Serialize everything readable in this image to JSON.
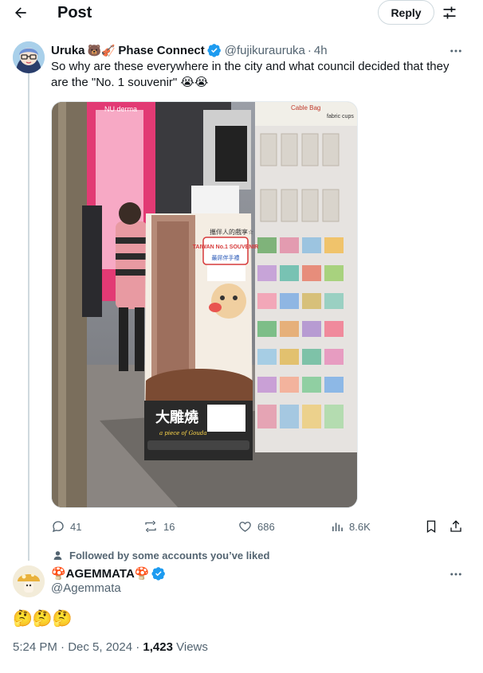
{
  "header": {
    "title": "Post",
    "reply_button": "Reply"
  },
  "tweet": {
    "author_name": "Uruka",
    "author_emoji": "🐻🎻",
    "author_org": "Phase Connect",
    "handle": "@fujikurauruka",
    "separator": "·",
    "time": "4h",
    "text": "So why are these everywhere in the city and what council decided that they are the \"No. 1 souvenir\" 😭😭",
    "media_sign_text": {
      "top": "攜伴人的戲享☆",
      "badge": "TAIWAN No.1 SOUVENIR",
      "subbadge": "最屌伴手禮",
      "brand": "大雕燒",
      "brand_sub": "a piece of Gouda",
      "shop_tag1": "NU derma",
      "shop_tag2": "Cable Bag",
      "shop_tag3": "fabric cups"
    },
    "stats": {
      "replies": "41",
      "reposts": "16",
      "likes": "686",
      "views": "8.6K"
    }
  },
  "reply": {
    "followed_note": "Followed by some accounts you’ve liked",
    "author_name": "🍄AGEMMATA🍄",
    "handle": "@Agemmata",
    "text": "🤔🤔🤔",
    "timestamp": "5:24 PM · Dec 5, 2024 · ",
    "views_count": "1,423",
    "views_label": " Views"
  },
  "colors": {
    "text": "#0f1419",
    "muted": "#536471",
    "verified": "#1d9bf0",
    "border": "#cfd9de"
  }
}
